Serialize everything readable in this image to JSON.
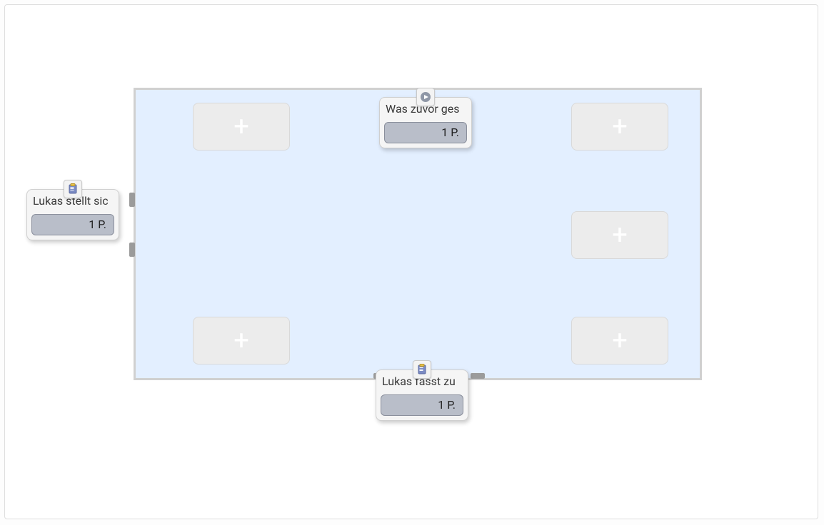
{
  "slot_icon": "plus",
  "cards": {
    "top": {
      "title": "Was zuvor ges",
      "points": "1 P.",
      "badge_icon": "play"
    },
    "left": {
      "title": "Lukas stellt sic",
      "points": "1 P.",
      "badge_icon": "clipboard"
    },
    "bottom": {
      "title": "Lukas fasst zu",
      "points": "1 P.",
      "badge_icon": "clipboard"
    }
  }
}
